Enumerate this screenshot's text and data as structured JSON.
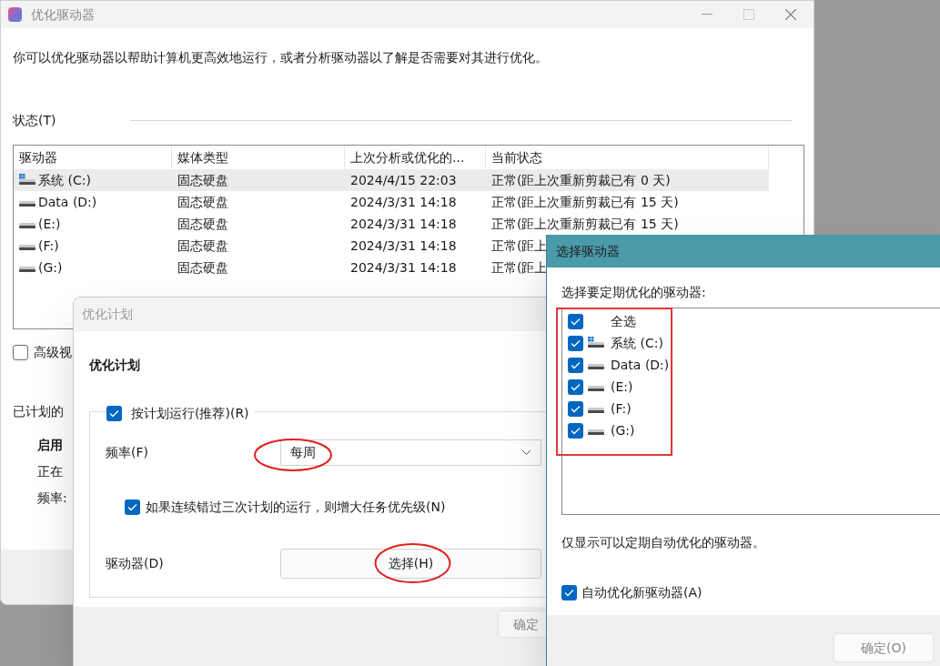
{
  "main_window": {
    "title": "优化驱动器",
    "description": "你可以优化驱动器以帮助计算机更高效地运行，或者分析驱动器以了解是否需要对其进行优化。",
    "status_label": "状态(T)",
    "table": {
      "columns": [
        "驱动器",
        "媒体类型",
        "上次分析或优化的...",
        "当前状态"
      ],
      "rows": [
        {
          "kind": "system",
          "drive": "系统 (C:)",
          "media": "固态硬盘",
          "last_run": "2024/4/15 22:03",
          "status": "正常(距上次重新剪裁已有 0 天)",
          "selected": true
        },
        {
          "kind": "drive",
          "drive": "Data (D:)",
          "media": "固态硬盘",
          "last_run": "2024/3/31 14:18",
          "status": "正常(距上次重新剪裁已有 15 天)",
          "selected": false
        },
        {
          "kind": "drive",
          "drive": "(E:)",
          "media": "固态硬盘",
          "last_run": "2024/3/31 14:18",
          "status": "正常(距上次重新剪裁已有 15 天)",
          "selected": false
        },
        {
          "kind": "drive",
          "drive": "(F:)",
          "media": "固态硬盘",
          "last_run": "2024/3/31 14:18",
          "status": "正常(距上",
          "selected": false
        },
        {
          "kind": "drive",
          "drive": "(G:)",
          "media": "固态硬盘",
          "last_run": "2024/3/31 14:18",
          "status": "正常(距上",
          "selected": false
        }
      ]
    },
    "advanced_view": {
      "label": "高级视",
      "checked": false
    },
    "scheduled_label": "已计划的",
    "schedule_info": [
      {
        "text": "启用",
        "bold": true
      },
      {
        "text": "正在",
        "bold": false
      },
      {
        "text": "频率:",
        "bold": false
      }
    ]
  },
  "schedule_dialog": {
    "title": "优化计划",
    "heading": "优化计划",
    "run_on_schedule": {
      "label": "按计划运行(推荐)(R)",
      "checked": true
    },
    "frequency": {
      "label": "频率(F)",
      "value": "每周"
    },
    "raise_priority": {
      "label": "如果连续错过三次计划的运行，则增大任务优先级(N)",
      "checked": true
    },
    "drives": {
      "label": "驱动器(D)",
      "button": "选择(H)"
    },
    "ok_button": "确定"
  },
  "select_dialog": {
    "title": "选择驱动器",
    "prompt": "选择要定期优化的驱动器:",
    "items": [
      {
        "kind": "all",
        "label": "全选",
        "checked": true
      },
      {
        "kind": "system",
        "label": "系统 (C:)",
        "checked": true
      },
      {
        "kind": "drive",
        "label": "Data (D:)",
        "checked": true
      },
      {
        "kind": "drive",
        "label": "(E:)",
        "checked": true
      },
      {
        "kind": "drive",
        "label": "(F:)",
        "checked": true
      },
      {
        "kind": "drive",
        "label": "(G:)",
        "checked": true
      }
    ],
    "note": "仅显示可以定期自动优化的驱动器。",
    "auto_new": {
      "label": "自动优化新驱动器(A)",
      "checked": true
    },
    "ok_button": "确定(O)"
  }
}
